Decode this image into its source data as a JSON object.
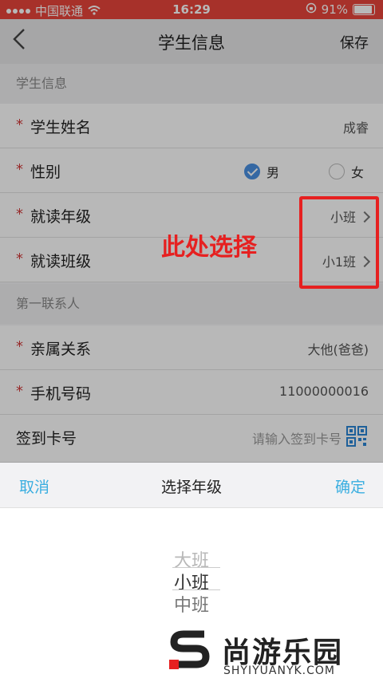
{
  "statusbar": {
    "carrier": "中国联通",
    "time": "16:29",
    "battery": "91%"
  },
  "nav": {
    "title": "学生信息",
    "save_label": "保存"
  },
  "sections": {
    "student": "学生信息",
    "contact": "第一联系人"
  },
  "student": {
    "name_label": "学生姓名",
    "name_value": "成睿",
    "gender_label": "性别",
    "gender_male": "男",
    "gender_female": "女",
    "gender_selected": "男",
    "grade_label": "就读年级",
    "grade_value": "小班",
    "class_label": "就读班级",
    "class_value": "小1班"
  },
  "contact": {
    "relation_label": "亲属关系",
    "relation_value": "大他(爸爸)",
    "phone_label": "手机号码",
    "phone_value": "11000000016",
    "card_label": "签到卡号",
    "card_placeholder": "请输入签到卡号"
  },
  "annotation": {
    "text": "此处选择",
    "color": "#e62020"
  },
  "picker": {
    "cancel": "取消",
    "title": "选择年级",
    "confirm": "确定",
    "options": [
      "大班",
      "小班",
      "中班"
    ]
  },
  "watermark": {
    "main": "尚游乐园",
    "sub": "SHYIYUANYK.COM"
  },
  "colors": {
    "accent": "#3aaee0",
    "statusbar": "#e8453b",
    "radio_on": "#4a90e2",
    "required": "#d23a3a"
  }
}
